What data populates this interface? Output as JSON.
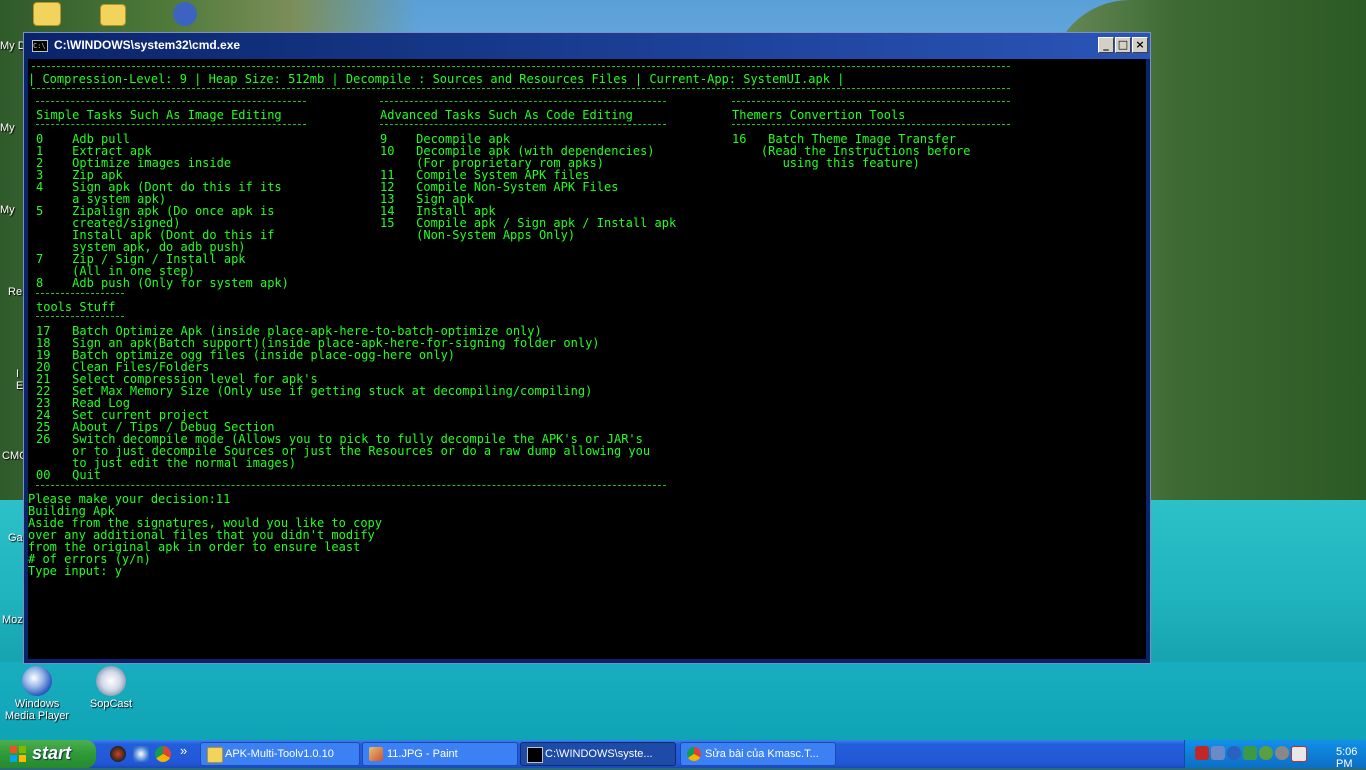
{
  "desktop": {
    "icons": [
      {
        "label": "Windows Media Player",
        "icon": "media-player-icon"
      },
      {
        "label": "SopCast",
        "icon": "sopcast-icon"
      }
    ],
    "edge_labels": [
      "My D",
      "My",
      "My",
      "Re",
      "I",
      "E",
      "CMC",
      "Ga",
      "Moz"
    ]
  },
  "window": {
    "title": "C:\\WINDOWS\\system32\\cmd.exe",
    "minimize_glyph": "_",
    "maximize_glyph": "□",
    "close_glyph": "×"
  },
  "console": {
    "status_line": "| Compression-Level: 9 | Heap Size: 512mb | Decompile : Sources and Resources Files | Current-App: SystemUI.apk |",
    "simple_header": "Simple Tasks Such As Image Editing",
    "advanced_header": "Advanced Tasks Such As Code Editing",
    "themers_header": "Themers Convertion Tools",
    "simple_lines": [
      "0    Adb pull",
      "1    Extract apk",
      "2    Optimize images inside",
      "3    Zip apk",
      "4    Sign apk (Dont do this if its",
      "     a system apk)",
      "5    Zipalign apk (Do once apk is",
      "     created/signed)",
      "     Install apk (Dont do this if",
      "     system apk, do adb push)",
      "7    Zip / Sign / Install apk",
      "     (All in one step)",
      "8    Adb push (Only for system apk)"
    ],
    "advanced_lines": [
      "9    Decompile apk",
      "10   Decompile apk (with dependencies)",
      "     (For proprietary rom apks)",
      "11   Compile System APK files",
      "12   Compile Non-System APK Files",
      "13   Sign apk",
      "14   Install apk",
      "15   Compile apk / Sign apk / Install apk",
      "     (Non-System Apps Only)"
    ],
    "themers_lines": [
      "16   Batch Theme Image Transfer",
      "    (Read the Instructions before",
      "       using this feature)"
    ],
    "tools_header": "tools Stuff",
    "tools_lines": [
      "17   Batch Optimize Apk (inside place-apk-here-to-batch-optimize only)",
      "18   Sign an apk(Batch support)(inside place-apk-here-for-signing folder only)",
      "19   Batch optimize ogg files (inside place-ogg-here only)",
      "20   Clean Files/Folders",
      "21   Select compression level for apk's",
      "22   Set Max Memory Size (Only use if getting stuck at decompiling/compiling)",
      "23   Read Log",
      "24   Set current project",
      "25   About / Tips / Debug Section",
      "26   Switch decompile mode (Allows you to pick to fully decompile the APK's or JAR's",
      "     or to just decompile Sources or just the Resources or do a raw dump allowing you",
      "     to just edit the normal images)",
      "00   Quit"
    ],
    "output_lines": [
      "Please make your decision:11",
      "Building Apk",
      "Aside from the signatures, would you like to copy",
      "over any additional files that you didn't modify",
      "from the original apk in order to ensure least",
      "# of errors (y/n)",
      "Type input: y"
    ]
  },
  "taskbar": {
    "start_label": "start",
    "quicklaunch_more": "»",
    "tasks": [
      {
        "label": "APK-Multi-Toolv1.0.10",
        "icon": "folder-icon",
        "active": false
      },
      {
        "label": "11.JPG - Paint",
        "icon": "paint-icon",
        "active": false
      },
      {
        "label": "C:\\WINDOWS\\syste...",
        "icon": "cmd-icon",
        "active": true
      },
      {
        "label": "Sửa bài của Kmasc.T...",
        "icon": "chrome-icon",
        "active": false
      }
    ],
    "clock": "5:06 PM"
  },
  "colors": {
    "console_text": "#20ff20",
    "console_bg": "#000000",
    "titlebar": "#0a246a",
    "taskbar": "#245edb",
    "start": "#2f9a37"
  }
}
